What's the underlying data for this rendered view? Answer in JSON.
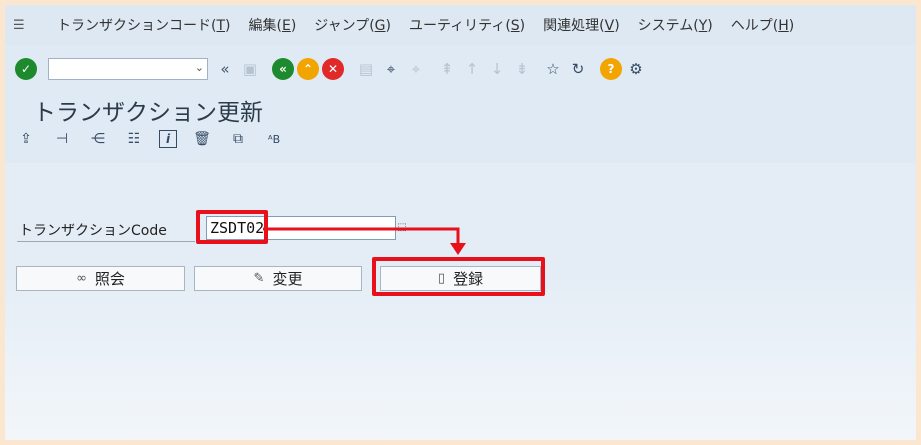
{
  "menu": {
    "items": [
      {
        "label": "トランザクションコード",
        "key": "T"
      },
      {
        "label": "編集",
        "key": "E"
      },
      {
        "label": "ジャンプ",
        "key": "G"
      },
      {
        "label": "ユーティリティ",
        "key": "S"
      },
      {
        "label": "関連処理",
        "key": "V"
      },
      {
        "label": "システム",
        "key": "Y"
      },
      {
        "label": "ヘルプ",
        "key": "H"
      }
    ]
  },
  "toolbar": {
    "command_value": ""
  },
  "page": {
    "title": "トランザクション更新"
  },
  "form": {
    "label": "トランザクションCode",
    "value": "ZSDT02"
  },
  "buttons": {
    "display": "照会",
    "change": "変更",
    "create": "登録"
  },
  "colors": {
    "highlight": "#e8101a",
    "confirm": "#1e8a2e",
    "nav": "#f2a400",
    "cancel": "#e02a2a"
  }
}
